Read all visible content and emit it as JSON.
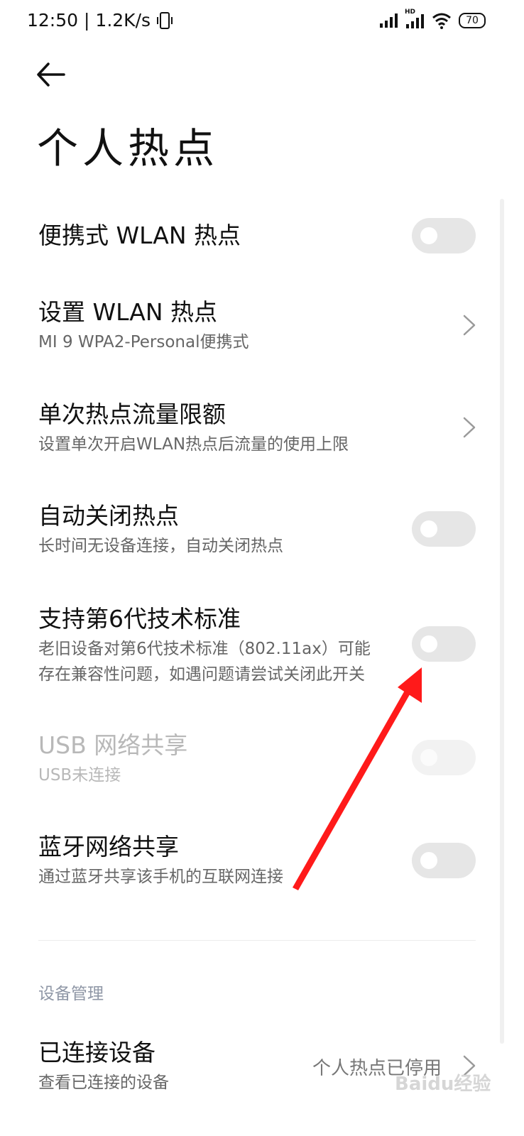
{
  "status_bar": {
    "time": "12:50",
    "speed": "| 1.2K/s",
    "hd_label": "HD",
    "battery": "70"
  },
  "header": {
    "title": "个人热点"
  },
  "settings": [
    {
      "title": "便携式 WLAN 热点",
      "subtitle": "",
      "control": "toggle",
      "on": false,
      "enabled": true
    },
    {
      "title": "设置 WLAN 热点",
      "subtitle": "MI 9 WPA2-Personal便携式",
      "control": "chevron"
    },
    {
      "title": "单次热点流量限额",
      "subtitle": "设置单次开启WLAN热点后流量的使用上限",
      "control": "chevron"
    },
    {
      "title": "自动关闭热点",
      "subtitle": "长时间无设备连接，自动关闭热点",
      "control": "toggle",
      "on": false,
      "enabled": true
    },
    {
      "title": "支持第6代技术标准",
      "subtitle_lines": [
        "老旧设备对第6代技术标准（802.11ax）可能",
        "存在兼容性问题，如遇问题请尝试关闭此开关"
      ],
      "control": "toggle",
      "on": false,
      "enabled": true
    },
    {
      "title": "USB 网络共享",
      "subtitle": "USB未连接",
      "control": "toggle",
      "on": false,
      "enabled": false
    },
    {
      "title": "蓝牙网络共享",
      "subtitle": "通过蓝牙共享该手机的互联网连接",
      "control": "toggle",
      "on": false,
      "enabled": true
    }
  ],
  "device_section": {
    "header": "设备管理",
    "connected_devices": {
      "title": "已连接设备",
      "subtitle": "查看已连接的设备",
      "value": "个人热点已停用"
    }
  },
  "watermark": "Baidu经验",
  "colors": {
    "toggle_off": "#e6e6e6",
    "section_header": "#8f97a6",
    "annotation_arrow": "#ff1a1a"
  }
}
